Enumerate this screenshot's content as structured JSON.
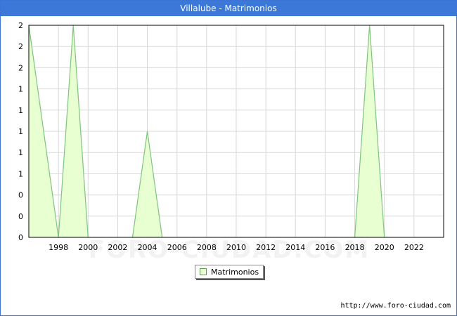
{
  "header": {
    "title": "Villalube - Matrimonios"
  },
  "source": "http://www.foro-ciudad.com",
  "watermark": "FORO-CIUDAD.COM",
  "colors": {
    "titlebar": "#3c78d8",
    "area_fill": "#e8ffd2",
    "area_line": "#7fc47f",
    "grid": "#d8d8d8"
  },
  "chart_data": {
    "type": "area",
    "title": "Villalube - Matrimonios",
    "xlabel": "",
    "ylabel": "",
    "xlim": [
      1996,
      2024
    ],
    "ylim": [
      0,
      2
    ],
    "grid": true,
    "legend_position": "bottom-center",
    "x_ticks": [
      1998,
      2000,
      2002,
      2004,
      2006,
      2008,
      2010,
      2012,
      2014,
      2016,
      2018,
      2020,
      2022
    ],
    "y_tick_values": [
      0,
      0.2,
      0.4,
      0.6,
      0.8,
      1.0,
      1.2,
      1.4,
      1.6,
      1.8,
      2.0
    ],
    "y_tick_labels": [
      "0",
      "0",
      "0",
      "1",
      "1",
      "1",
      "1",
      "1",
      "2",
      "2",
      "2"
    ],
    "series": [
      {
        "name": "Matrimonios",
        "x": [
          1996,
          1997,
          1998,
          1999,
          2000,
          2001,
          2002,
          2003,
          2004,
          2005,
          2006,
          2007,
          2008,
          2009,
          2010,
          2011,
          2012,
          2013,
          2014,
          2015,
          2016,
          2017,
          2018,
          2019,
          2020
        ],
        "values": [
          2,
          1,
          0,
          2,
          0,
          null,
          null,
          0,
          1,
          0,
          null,
          null,
          null,
          null,
          null,
          null,
          null,
          null,
          null,
          null,
          null,
          null,
          0,
          2,
          0
        ]
      }
    ]
  }
}
